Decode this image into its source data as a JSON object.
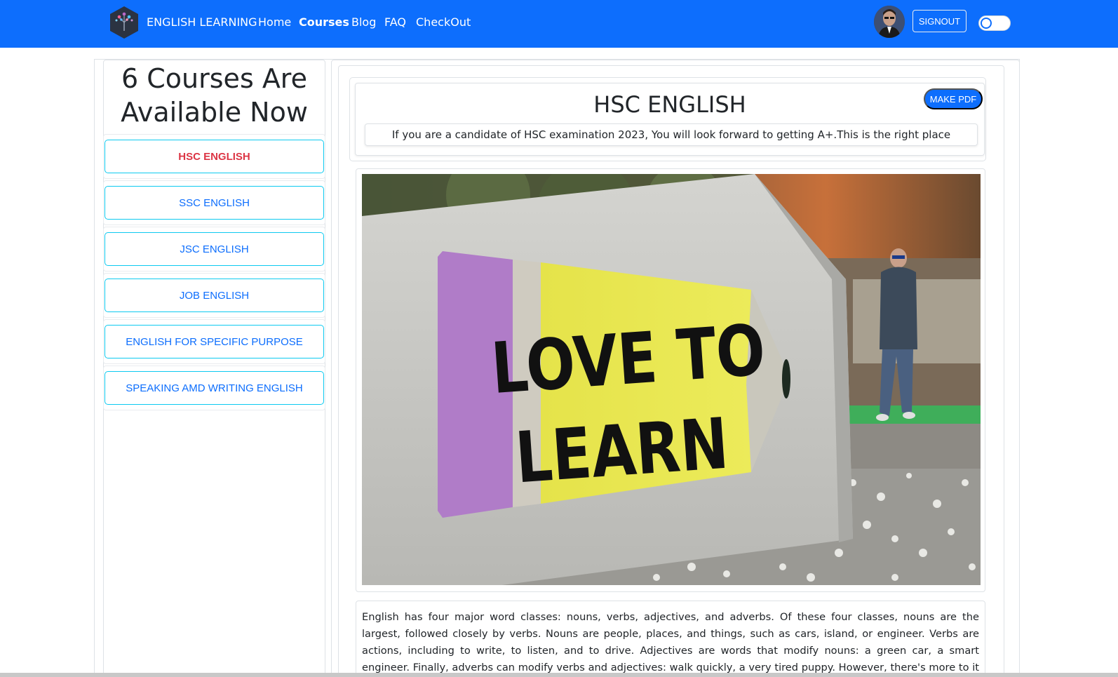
{
  "navbar": {
    "brand": "ENGLISH LEARNING",
    "links": [
      "Home",
      "Courses",
      "Blog",
      "FAQ",
      "CheckOut"
    ],
    "active_link": "Courses",
    "signout_label": "SIGNOUT",
    "accent_color": "#0d6efd"
  },
  "sidebar": {
    "title": "6 Courses Are Available Now",
    "courses": [
      "HSC ENGLISH",
      "SSC ENGLISH",
      "JSC ENGLISH",
      "JOB ENGLISH",
      "ENGLISH FOR SPECIFIC PURPOSE",
      "SPEAKING AMD WRITING ENGLISH"
    ],
    "active_course": "HSC ENGLISH"
  },
  "course": {
    "title": "HSC ENGLISH",
    "make_pdf_label": "MAKE PDF",
    "subtitle": "If you are a candidate of HSC examination 2023, You will look forward to getting A+.This is the right place",
    "image_text": [
      "LOVE TO",
      "LEARN"
    ],
    "description": "English has four major word classes: nouns, verbs, adjectives, and adverbs. Of these four classes, nouns are the largest, followed closely by verbs. Nouns are people, places, and things, such as cars, island, or engineer. Verbs are actions, including to write, to listen, and to drive. Adjectives are words that modify nouns: a green car, a smart engineer. Finally, adverbs can modify verbs and adjectives: walk quickly, a very tired puppy. However, there's more to it than just those four word classes."
  }
}
